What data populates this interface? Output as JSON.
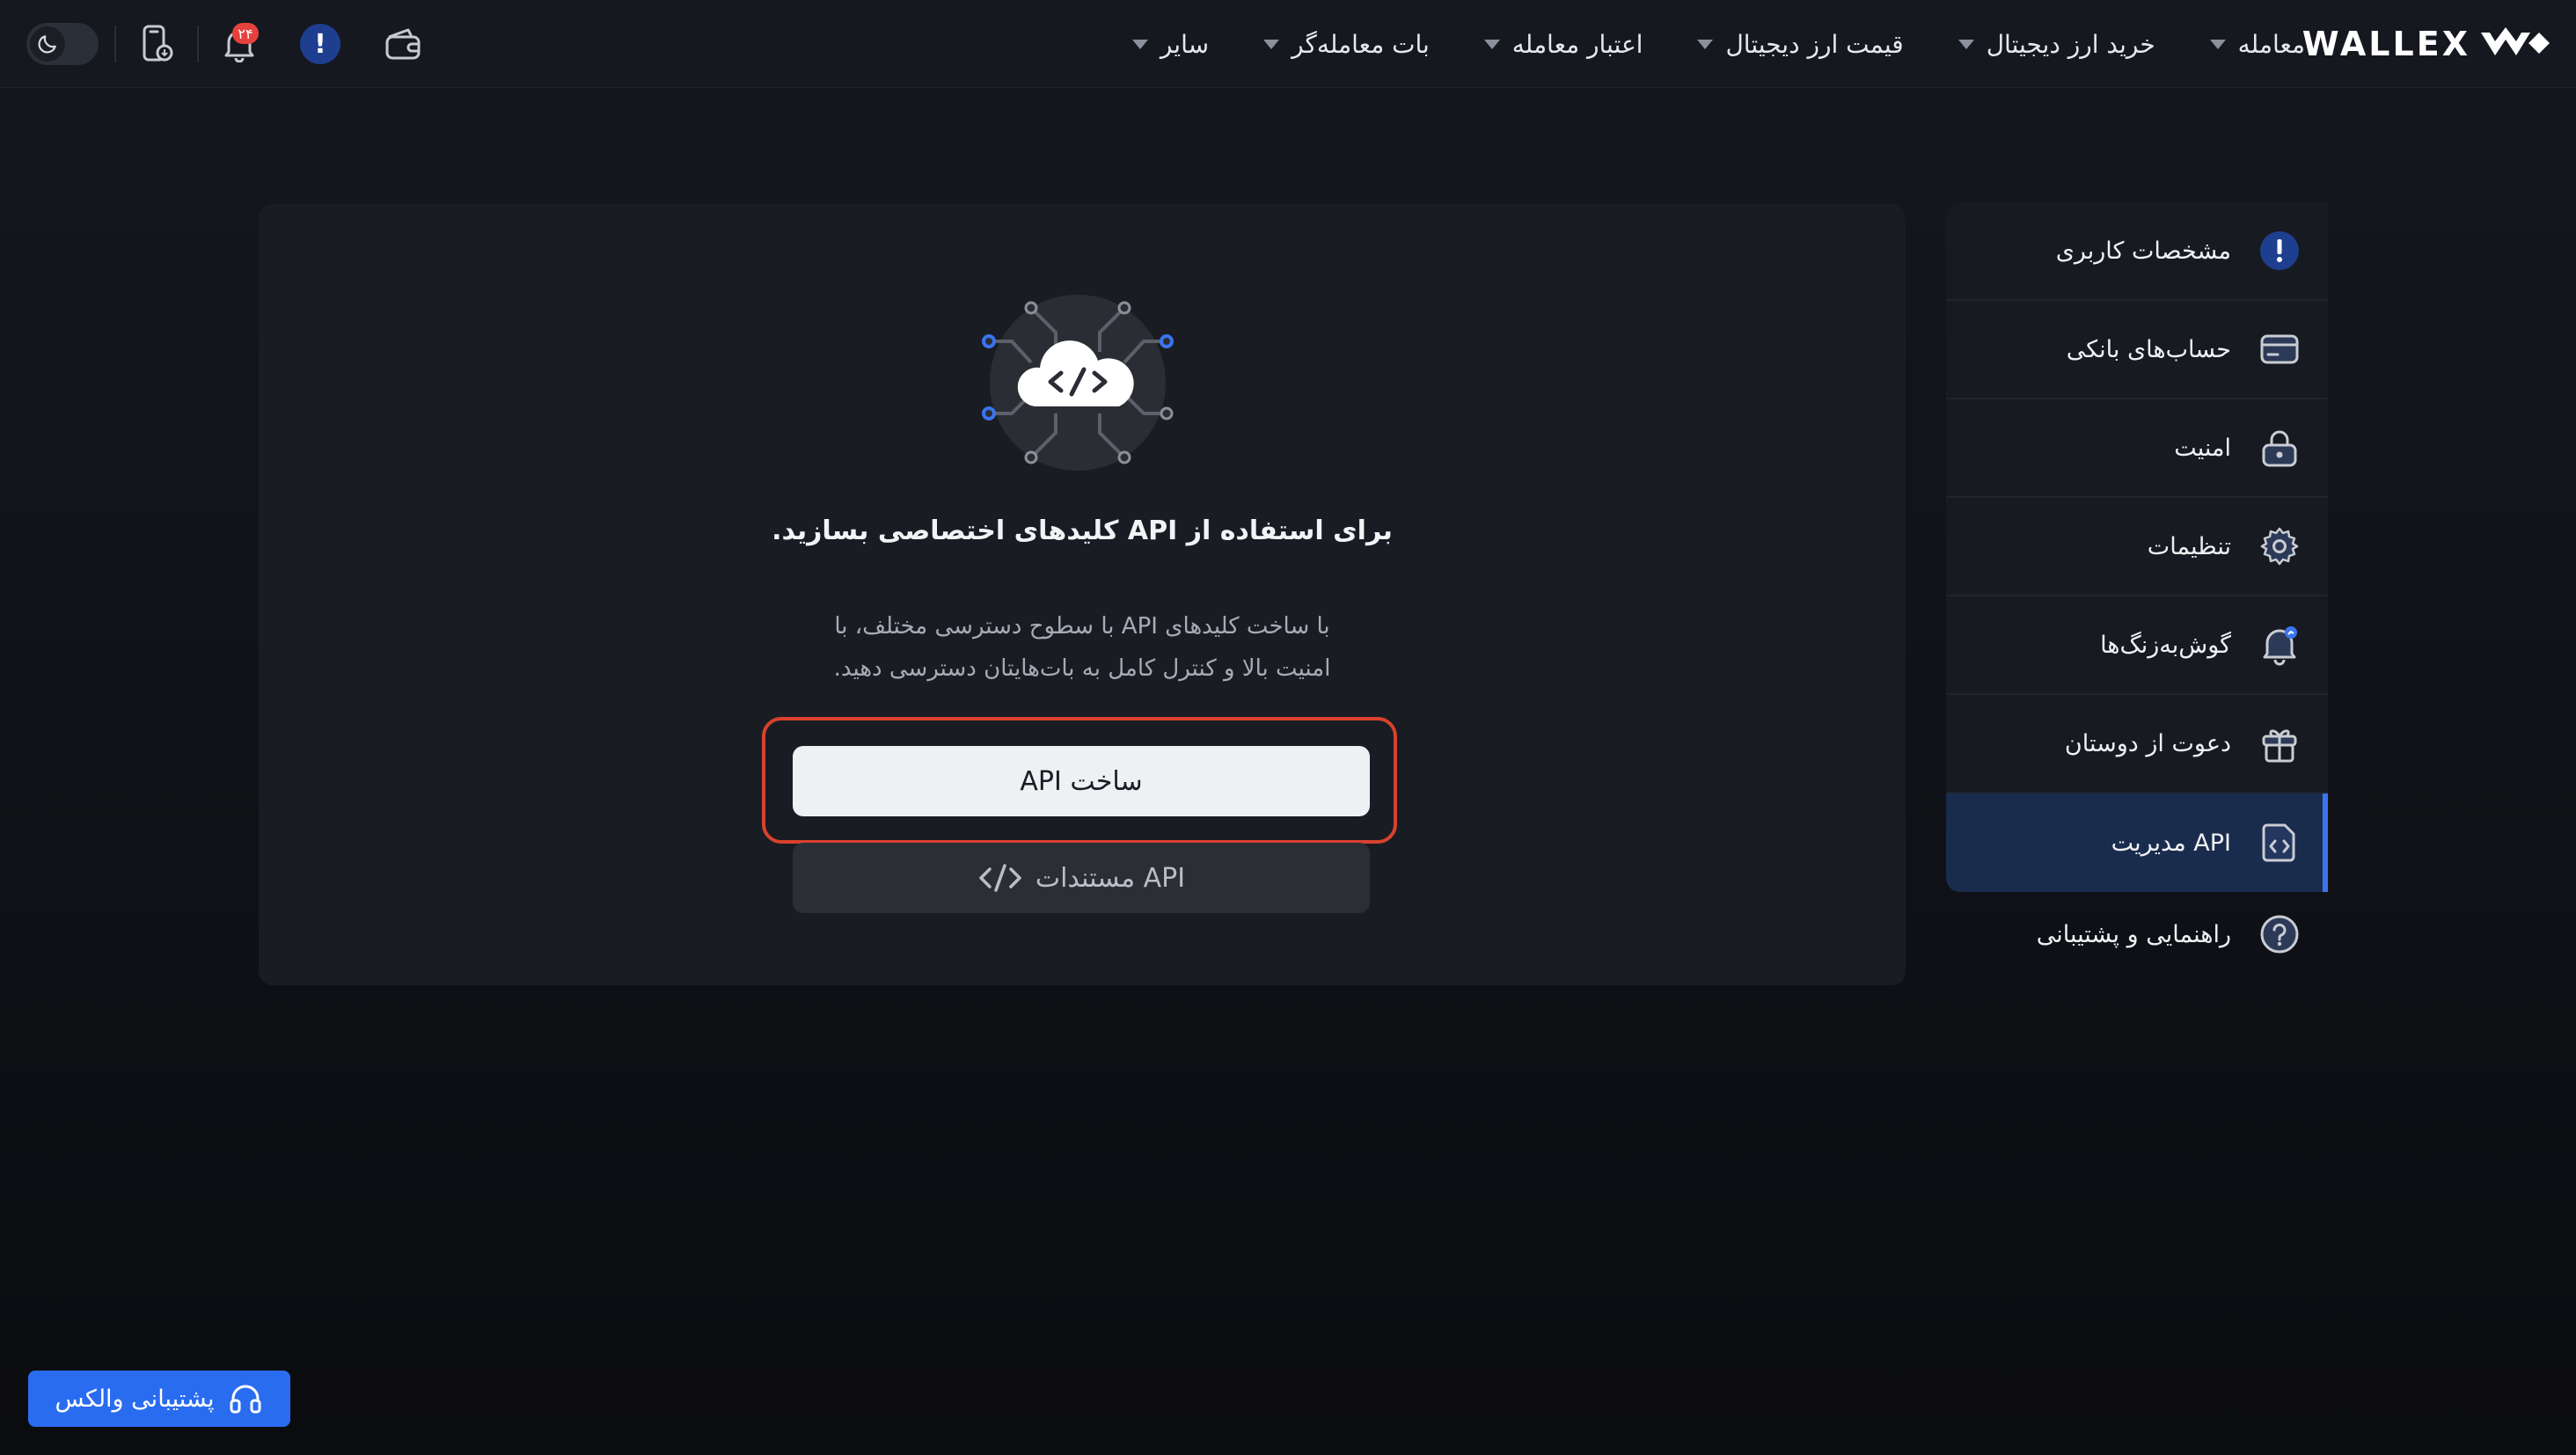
{
  "brand": {
    "name": "WALLEX"
  },
  "nav": {
    "items": [
      {
        "label": "معامله"
      },
      {
        "label": "خرید ارز دیجیتال"
      },
      {
        "label": "قیمت ارز دیجیتال"
      },
      {
        "label": "اعتبار معامله"
      },
      {
        "label": "بات معامله‌گر"
      },
      {
        "label": "سایر"
      }
    ],
    "notifications_count": "۲۴",
    "alert_symbol": "!"
  },
  "sidebar": {
    "items": [
      {
        "label": "مشخصات کاربری",
        "icon": "alert-icon"
      },
      {
        "label": "حساب‌های بانکی",
        "icon": "card-icon"
      },
      {
        "label": "امنیت",
        "icon": "lock-icon"
      },
      {
        "label": "تنظیمات",
        "icon": "gear-icon"
      },
      {
        "label": "گوش‌به‌زنگ‌ها",
        "icon": "bell-icon"
      },
      {
        "label": "دعوت از دوستان",
        "icon": "gift-icon"
      },
      {
        "label": "مدیریت API",
        "icon": "code-file-icon",
        "active": true
      }
    ],
    "help": {
      "label": "راهنمایی و پشتیبانی",
      "icon": "help-icon"
    }
  },
  "main": {
    "headline": "برای استفاده از API کلیدهای اختصاصی بسازید.",
    "subtext_line1": "با ساخت کلیدهای API با سطوح دسترسی مختلف، با",
    "subtext_line2": "امنیت بالا و کنترل کامل به بات‌هایتان دسترسی دهید.",
    "primary_button": "ساخت API",
    "secondary_button": "مستندات API"
  },
  "support": {
    "label": "پشتیبانی والکس"
  },
  "colors": {
    "accent": "#2a6cf0",
    "active_bg": "#1a2c4d",
    "highlight_border": "#d9412f",
    "badge": "#e5413e"
  }
}
